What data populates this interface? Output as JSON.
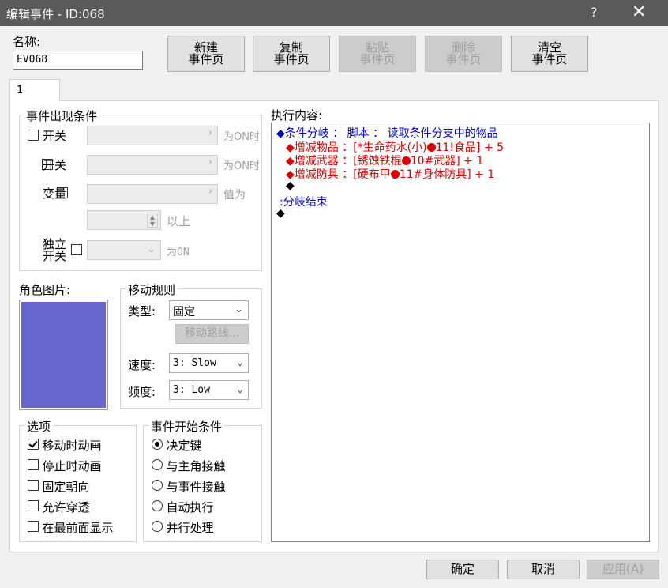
{
  "window": {
    "title": "编辑事件 - ID:068",
    "help": "?",
    "close": "✕"
  },
  "name_label": "名称:",
  "name_value": "EV068",
  "toolbar": {
    "new": [
      "新建",
      "事件页"
    ],
    "copy": [
      "复制",
      "事件页"
    ],
    "paste": [
      "粘贴",
      "事件页"
    ],
    "delete": [
      "删除",
      "事件页"
    ],
    "clear": [
      "清空",
      "事件页"
    ]
  },
  "tab": {
    "label": "1"
  },
  "conditions": {
    "title": "事件出现条件",
    "switch1": {
      "label": "开关",
      "suffix": "为ON时"
    },
    "switch2": {
      "label": "开关",
      "suffix": "为ON时"
    },
    "variable": {
      "label": "变量",
      "suffix": "值为",
      "suffix2": "以上"
    },
    "self_switch": {
      "label1": "独立",
      "label2": "开关",
      "suffix": "为ON"
    }
  },
  "graphic": {
    "label": "角色图片:",
    "color": "#6666cc"
  },
  "movement": {
    "title": "移动规则",
    "type_label": "类型:",
    "type_value": "固定",
    "route_button": "移动路线...",
    "speed_label": "速度:",
    "speed_value": "3: Slow",
    "freq_label": "频度:",
    "freq_value": "3: Low"
  },
  "options": {
    "title": "选项",
    "items": [
      {
        "label": "移动时动画",
        "checked": true
      },
      {
        "label": "停止时动画",
        "checked": false
      },
      {
        "label": "固定朝向",
        "checked": false
      },
      {
        "label": "允许穿透",
        "checked": false
      },
      {
        "label": "在最前面显示",
        "checked": false
      }
    ]
  },
  "trigger": {
    "title": "事件开始条件",
    "items": [
      {
        "label": "决定键",
        "selected": true
      },
      {
        "label": "与主角接触",
        "selected": false
      },
      {
        "label": "与事件接触",
        "selected": false
      },
      {
        "label": "自动执行",
        "selected": false
      },
      {
        "label": "并行处理",
        "selected": false
      }
    ]
  },
  "contents": {
    "label": "执行内容:",
    "lines": {
      "l1": "◆条件分岐 ： 脚本 ： 读取条件分支中的物品",
      "l2a": "◆增减物品 ：[*生命药水(小)",
      "l2b": "11!食品] + 5",
      "l3a": "◆增减武器 ：[锈蚀铁棍",
      "l3b": "10#武器] + 1",
      "l4a": "◆增减防具 ：[硬布甲",
      "l4b": "11#身体防具] + 1",
      "l5": "◆",
      "l6": ":分岐结束",
      "l7": "◆"
    }
  },
  "footer": {
    "ok": "确定",
    "cancel": "取消",
    "apply": "应用(A)"
  }
}
